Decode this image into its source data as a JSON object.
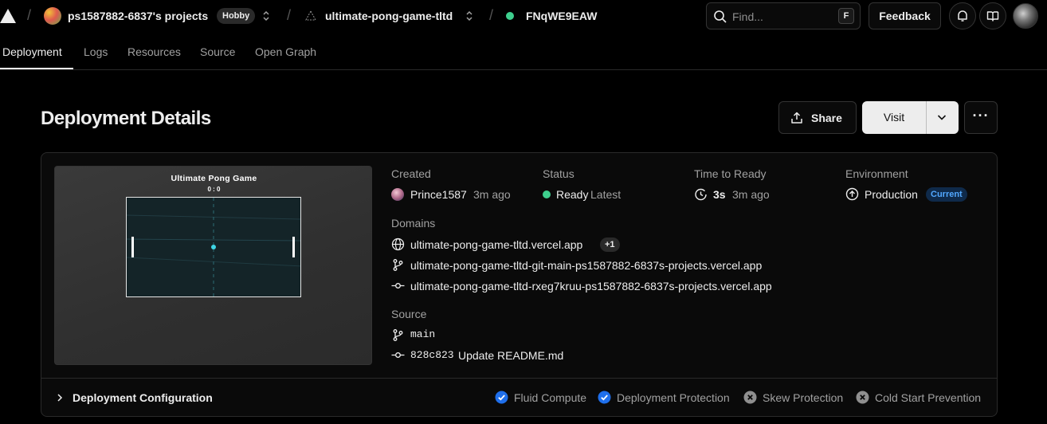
{
  "topbar": {
    "team_name": "ps1587882-6837's projects",
    "plan_badge": "Hobby",
    "project_name": "ultimate-pong-game-tltd",
    "deployment_id": "FNqWE9EAW",
    "search_placeholder": "Find...",
    "search_shortcut": "F",
    "feedback_label": "Feedback"
  },
  "tabs": [
    "Deployment",
    "Logs",
    "Resources",
    "Source",
    "Open Graph"
  ],
  "header": {
    "title": "Deployment Details",
    "share_label": "Share",
    "visit_label": "Visit",
    "more_label": "···"
  },
  "preview": {
    "game_title": "Ultimate Pong Game",
    "score": "0 : 0"
  },
  "details": {
    "created_label": "Created",
    "created_user": "Prince1587",
    "created_time": "3m ago",
    "status_label": "Status",
    "status_value": "Ready",
    "status_note": "Latest",
    "ttr_label": "Time to Ready",
    "ttr_value": "3s",
    "ttr_time": "3m ago",
    "env_label": "Environment",
    "env_value": "Production",
    "env_badge": "Current",
    "domains_label": "Domains",
    "domains": [
      "ultimate-pong-game-tltd.vercel.app",
      "ultimate-pong-game-tltd-git-main-ps1587882-6837s-projects.vercel.app",
      "ultimate-pong-game-tltd-rxeg7kruu-ps1587882-6837s-projects.vercel.app"
    ],
    "domains_more": "+1",
    "source_label": "Source",
    "branch": "main",
    "commit_hash": "828c823",
    "commit_message": "Update README.md"
  },
  "config": {
    "label": "Deployment Configuration",
    "features": [
      {
        "name": "Fluid Compute",
        "enabled": true
      },
      {
        "name": "Deployment Protection",
        "enabled": true
      },
      {
        "name": "Skew Protection",
        "enabled": false
      },
      {
        "name": "Cold Start Prevention",
        "enabled": false
      }
    ]
  },
  "colors": {
    "background": "#000000",
    "ready_green": "#3ecf8e",
    "accent_blue": "#52a8ff",
    "feature_on_blue": "#1f6feb"
  }
}
